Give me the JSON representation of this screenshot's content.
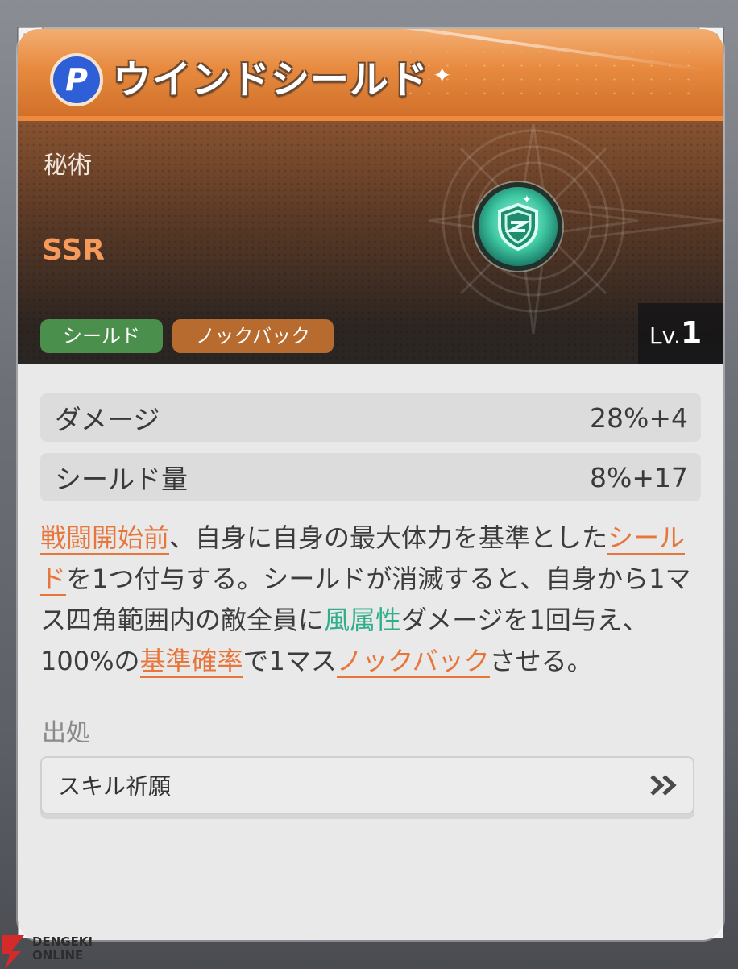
{
  "skill": {
    "name": "ウインドシールド",
    "category": "秘術",
    "rarity": "SSR",
    "tags": [
      "シールド",
      "ノックバック"
    ],
    "level_prefix": "Lv.",
    "level_value": "1"
  },
  "stats": [
    {
      "label": "ダメージ",
      "value": "28%+4"
    },
    {
      "label": "シールド量",
      "value": "8%+17"
    }
  ],
  "description": {
    "segments": [
      {
        "text": "戦闘開始前",
        "style": "keyword"
      },
      {
        "text": "、自身に自身の最大体力を基準とした",
        "style": "plain"
      },
      {
        "text": "シールド",
        "style": "keyword"
      },
      {
        "text": "を1つ付与する。シールドが消滅すると、自身から1マス四角範囲内の敵全員に",
        "style": "plain"
      },
      {
        "text": "風属性",
        "style": "wind"
      },
      {
        "text": "ダメージを1回与え、100%の",
        "style": "plain"
      },
      {
        "text": "基準確率",
        "style": "keyword"
      },
      {
        "text": "で1マス",
        "style": "plain"
      },
      {
        "text": "ノックバック",
        "style": "keyword"
      },
      {
        "text": "させる。",
        "style": "plain"
      }
    ]
  },
  "source": {
    "label": "出処",
    "button": "スキル祈願"
  },
  "watermark": {
    "line1": "DENGEKI",
    "line2": "ONLINE"
  },
  "colors": {
    "accent_orange": "#e8753a",
    "wind_green": "#2fae8b",
    "tag_shield": "#4b8f4d",
    "tag_knockback": "#b86b2f"
  },
  "icons": [
    "skill-type-icon",
    "shield-skill-icon",
    "sparkle-icon",
    "double-chevron-right-icon",
    "corner-ornament-icon"
  ]
}
